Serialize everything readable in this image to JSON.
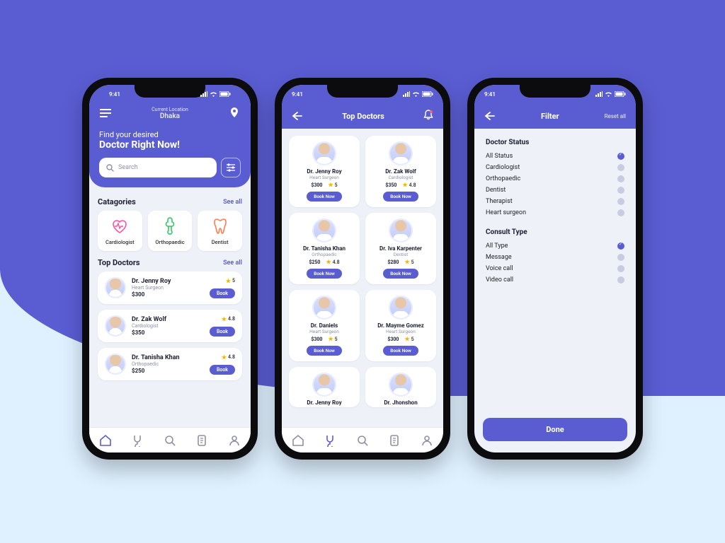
{
  "status": {
    "time": "9:41"
  },
  "home": {
    "location_label": "Current Location",
    "location_city": "Dhaka",
    "hero_line1": "Find your desired",
    "hero_line2": "Doctor Right Now!",
    "search_placeholder": "Search",
    "categories_title": "Catagories",
    "see_all": "See all",
    "categories": [
      {
        "label": "Cardiologist"
      },
      {
        "label": "Orthopaedic"
      },
      {
        "label": "Dentist"
      }
    ],
    "top_title": "Top Doctors",
    "doctors": [
      {
        "name": "Dr. Jenny Roy",
        "spec": "Heart Surgeon",
        "price": "$300",
        "rating": "5"
      },
      {
        "name": "Dr. Zak Wolf",
        "spec": "Cardiologist",
        "price": "$350",
        "rating": "4.8"
      },
      {
        "name": "Dr. Tanisha Khan",
        "spec": "Orthopaedic",
        "price": "$250",
        "rating": "4.8"
      }
    ],
    "book": "Book"
  },
  "grid": {
    "title": "Top Doctors",
    "book": "Book Now",
    "doctors": [
      {
        "name": "Dr. Jenny Roy",
        "spec": "Heart Surgeon",
        "price": "$300",
        "rating": "5"
      },
      {
        "name": "Dr. Zak Wolf",
        "spec": "Cardiologist",
        "price": "$350",
        "rating": "4.8"
      },
      {
        "name": "Dr. Tanisha Khan",
        "spec": "Orthopaedic",
        "price": "$250",
        "rating": "4.8"
      },
      {
        "name": "Dr. Iva Karpenter",
        "spec": "Dentist",
        "price": "$280",
        "rating": "5"
      },
      {
        "name": "Dr. Daniels",
        "spec": "Heart Surgeon",
        "price": "$300",
        "rating": "5"
      },
      {
        "name": "Dr. Mayme Gomez",
        "spec": "Heart Surgeon",
        "price": "$300",
        "rating": "5"
      },
      {
        "name": "Dr. Jenny Roy",
        "spec": "",
        "price": "",
        "rating": ""
      },
      {
        "name": "Dr. Jhonshon",
        "spec": "",
        "price": "",
        "rating": ""
      }
    ]
  },
  "filter": {
    "title": "Filter",
    "reset": "Reset all",
    "status_title": "Doctor Status",
    "status_options": [
      {
        "label": "All Status",
        "on": true
      },
      {
        "label": "Cardiologist",
        "on": false
      },
      {
        "label": "Orthopaedic",
        "on": false
      },
      {
        "label": "Dentist",
        "on": false
      },
      {
        "label": "Therapist",
        "on": false
      },
      {
        "label": "Heart surgeon",
        "on": false
      }
    ],
    "consult_title": "Consult Type",
    "consult_options": [
      {
        "label": "All Type",
        "on": true
      },
      {
        "label": "Message",
        "on": false
      },
      {
        "label": "Voice call",
        "on": false
      },
      {
        "label": "Video call",
        "on": false
      }
    ],
    "done": "Done"
  }
}
